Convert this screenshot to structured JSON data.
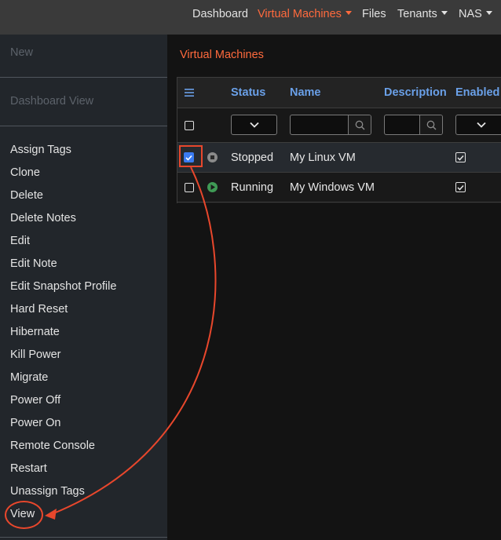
{
  "nav": {
    "items": [
      {
        "label": "Dashboard",
        "active": false,
        "dropdown": false
      },
      {
        "label": "Virtual Machines",
        "active": true,
        "dropdown": true
      },
      {
        "label": "Files",
        "active": false,
        "dropdown": false
      },
      {
        "label": "Tenants",
        "active": false,
        "dropdown": true
      },
      {
        "label": "NAS",
        "active": false,
        "dropdown": true
      }
    ]
  },
  "sidebar": {
    "disabled": [
      "New",
      "Dashboard View"
    ],
    "actions": [
      "Assign Tags",
      "Clone",
      "Delete",
      "Delete Notes",
      "Edit",
      "Edit Note",
      "Edit Snapshot Profile",
      "Hard Reset",
      "Hibernate",
      "Kill Power",
      "Migrate",
      "Power Off",
      "Power On",
      "Remote Console",
      "Restart",
      "Unassign Tags",
      "View"
    ]
  },
  "main": {
    "title": "Virtual Machines",
    "columns": {
      "menu_icon": "hamburger-icon",
      "status": "Status",
      "name": "Name",
      "description": "Description",
      "enabled": "Enabled"
    },
    "rows": [
      {
        "selected": true,
        "status_icon": "stop-icon",
        "status": "Stopped",
        "name": "My Linux VM",
        "enabled": true
      },
      {
        "selected": false,
        "status_icon": "play-icon",
        "status": "Running",
        "name": "My Windows VM",
        "enabled": true
      }
    ]
  },
  "colors": {
    "accent": "#ff6a3d",
    "header_text": "#6aa0e8",
    "annotation": "#e8472c",
    "running": "#3f9a55",
    "stopped": "#8a8a8a",
    "checkbox_selected": "#3a7bf2"
  }
}
